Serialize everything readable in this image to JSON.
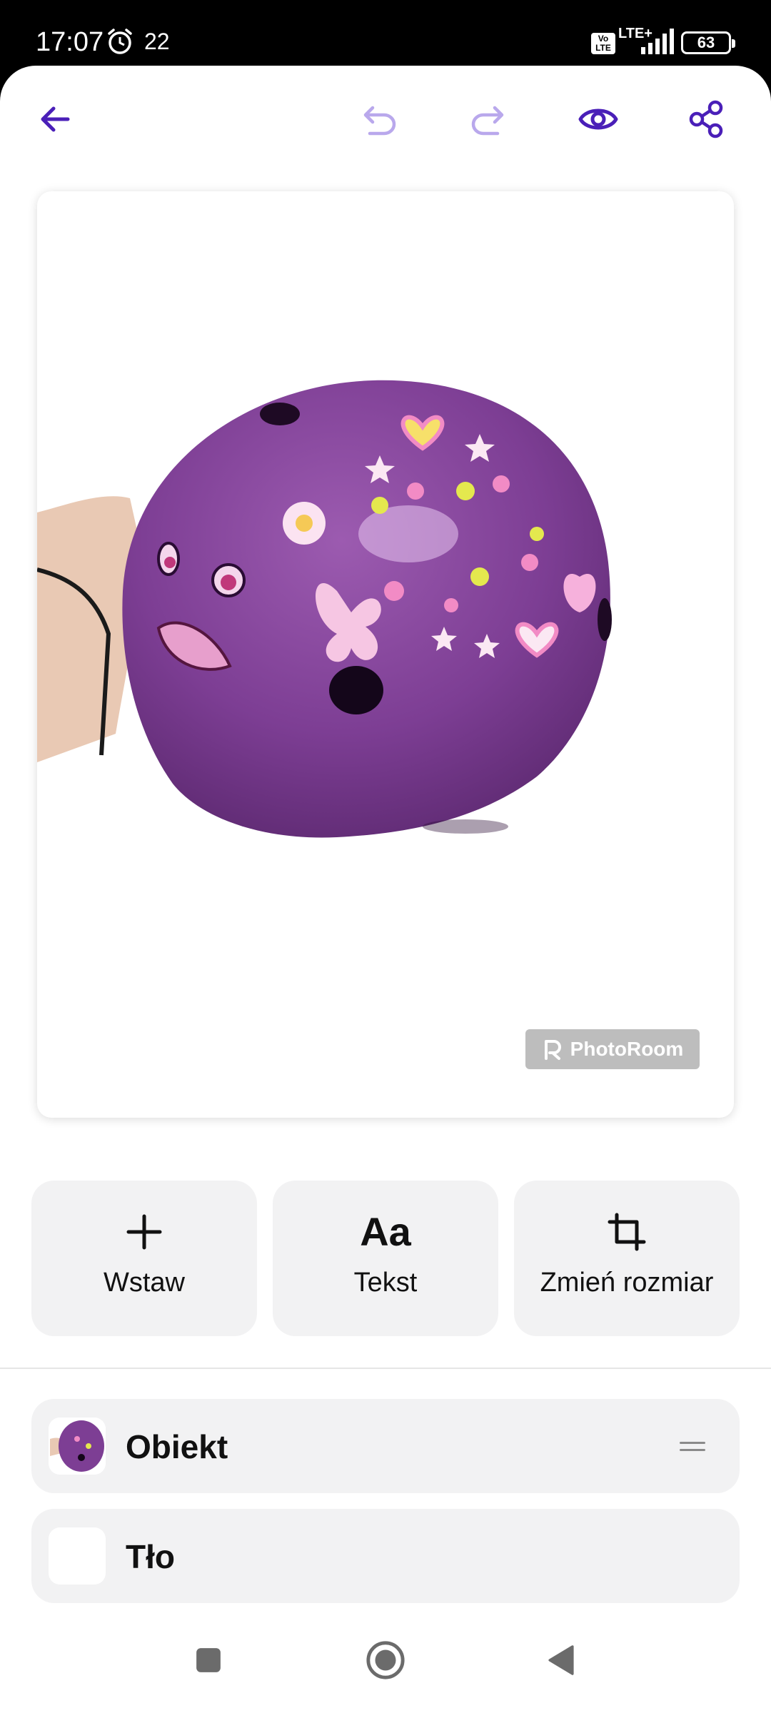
{
  "status_bar": {
    "time": "17:07",
    "temperature": "22",
    "network": "LTE+",
    "volte": "Vo LTE",
    "battery": "63"
  },
  "toolbar": {
    "back_icon": "arrow-left-icon",
    "undo_icon": "undo-icon",
    "redo_icon": "redo-icon",
    "preview_icon": "eye-icon",
    "share_icon": "share-icon",
    "accent_color": "#4a1fb8",
    "disabled_color": "#b9a8ec"
  },
  "canvas": {
    "watermark_text": "PhotoRoom"
  },
  "tools": [
    {
      "label": "Wstaw",
      "icon": "plus-icon"
    },
    {
      "label": "Tekst",
      "icon_text": "Aa"
    },
    {
      "label": "Zmień rozmiar",
      "icon": "crop-icon"
    }
  ],
  "layers": [
    {
      "label": "Obiekt"
    },
    {
      "label": "Tło"
    }
  ],
  "nav": {
    "recents_icon": "square-icon",
    "home_icon": "circle-icon",
    "back_icon": "triangle-back-icon"
  }
}
